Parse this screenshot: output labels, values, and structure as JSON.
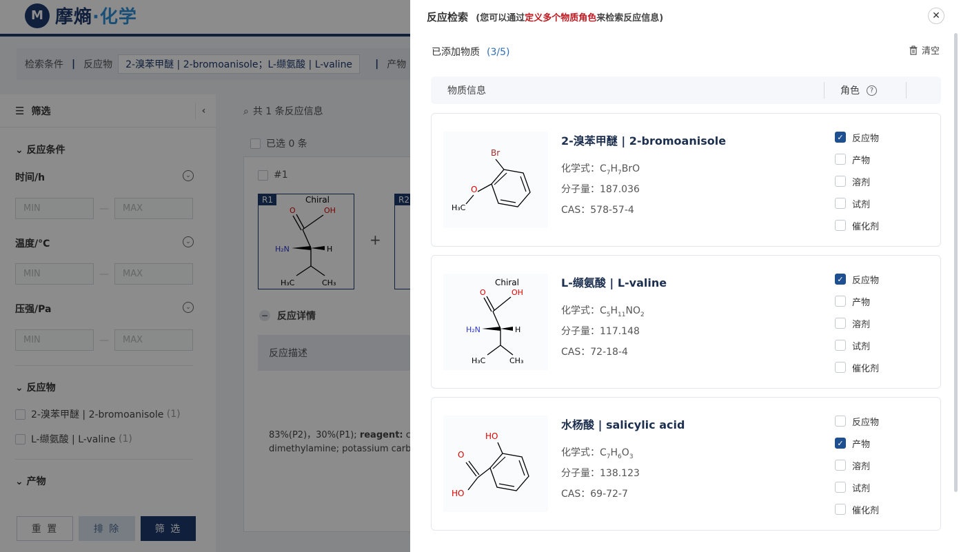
{
  "app": {
    "logo_mark": "M",
    "logo_name_a": "摩熵",
    "logo_name_b": "·化学"
  },
  "search": {
    "label": "检索条件",
    "reactant_label": "反应物",
    "reactant_value": "2-溴苯甲醚 | 2-bromoanisole；L-缬氨酸 | L-valine",
    "product_label": "产物"
  },
  "filter": {
    "title": "筛选",
    "section_conditions": "反应条件",
    "time_label": "时间/h",
    "temp_label": "温度/°C",
    "pressure_label": "压强/Pa",
    "min": "MIN",
    "max": "MAX",
    "section_reactants": "反应物",
    "reactant_items": [
      {
        "label": "2-溴苯甲醚 | 2-bromoanisole",
        "count": "(1)"
      },
      {
        "label": "L-缬氨酸 | L-valine",
        "count": "(1)"
      }
    ],
    "section_products": "产物",
    "btn_reset": "重 置",
    "btn_exclude": "排 除",
    "btn_filter": "筛 选"
  },
  "results": {
    "count_text": "共 1 条反应信息",
    "selected_text": "已选 0 条",
    "item_index": "#1",
    "r1_tag": "R1",
    "r2_tag": "R2",
    "chiral": "Chiral",
    "details_label": "反应详情",
    "description_label": "反应描述",
    "desc_line1_a": "83%(P2)，30%(P1); ",
    "desc_line1_b": "reagent:",
    "desc_line1_c": " co",
    "desc_line2": "dimethylamine; potassium carb"
  },
  "drawer": {
    "title": "反应检索",
    "hint_a": "(您可以通过",
    "hint_red": "定义多个物质角色",
    "hint_b": "来检索反应信息)",
    "added_label": "已添加物质",
    "added_count": "(3/5)",
    "clear_label": "清空",
    "col_info": "物质信息",
    "col_role": "角色",
    "formula_label": "化学式：",
    "mw_label": "分子量：",
    "cas_label": "CAS：",
    "role_names": [
      "反应物",
      "产物",
      "溶剂",
      "试剂",
      "催化剂"
    ],
    "substances": [
      {
        "name": "2-溴苯甲醚 | 2-bromoanisole",
        "formula_parts": [
          "C",
          "7",
          "H",
          "7",
          "BrO",
          ""
        ],
        "mw": "187.036",
        "cas": "578-57-4",
        "roles_checked": [
          true,
          false,
          false,
          false,
          false
        ]
      },
      {
        "name": "L-缬氨酸 | L-valine",
        "formula_parts": [
          "C",
          "5",
          "H",
          "11",
          "NO",
          "2"
        ],
        "mw": "117.148",
        "cas": "72-18-4",
        "roles_checked": [
          true,
          false,
          false,
          false,
          false
        ]
      },
      {
        "name": "水杨酸 | salicylic acid",
        "formula_parts": [
          "C",
          "7",
          "H",
          "6",
          "O",
          "3"
        ],
        "mw": "138.123",
        "cas": "69-72-7",
        "roles_checked": [
          false,
          true,
          false,
          false,
          false
        ]
      }
    ]
  },
  "colors": {
    "brand": "#1d3a6e",
    "accent_red": "#c0171f",
    "checkbox_on": "#1d4f91"
  }
}
